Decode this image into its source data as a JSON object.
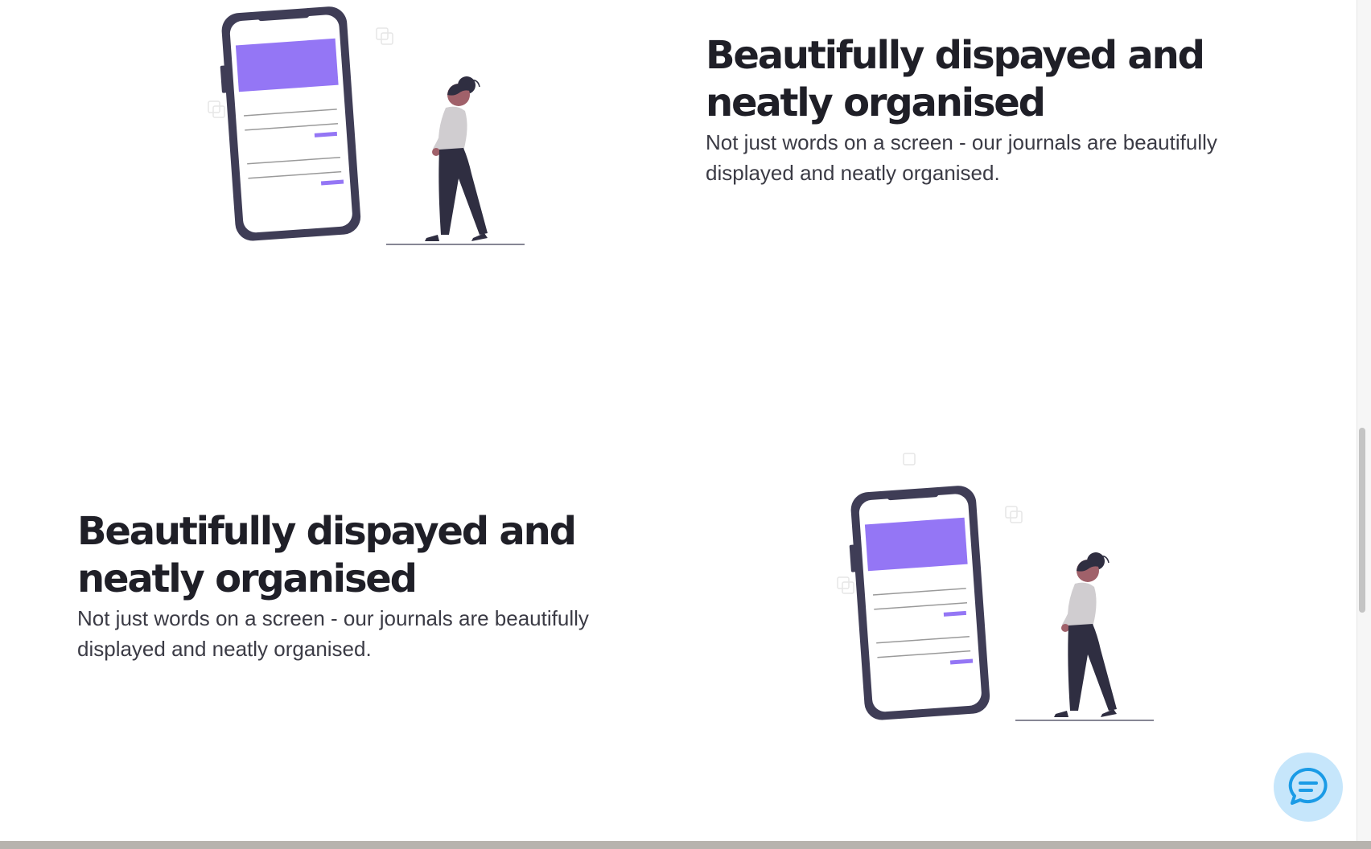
{
  "features": [
    {
      "heading_line1": "Beautifully dispayed and",
      "heading_line2": "neatly organised",
      "body_line1": "Not just words on a screen - our journals are beautifully",
      "body_line2": "displayed and neatly organised.",
      "illustration": "phone-woman-illustration"
    },
    {
      "heading_line1": "Beautifully dispayed and",
      "heading_line2": "neatly organised",
      "body_line1": "Not just words on a screen - our journals are beautifully",
      "body_line2": "displayed and neatly organised.",
      "illustration": "phone-woman-illustration"
    }
  ],
  "chat_widget": {
    "icon": "chat-bubble-icon"
  },
  "colors": {
    "accent_purple": "#9476f5",
    "phone_frame": "#3f3d56",
    "heading": "#1f1f27",
    "chat_bg": "#c6e6fb",
    "chat_icon": "#1a9be6"
  }
}
